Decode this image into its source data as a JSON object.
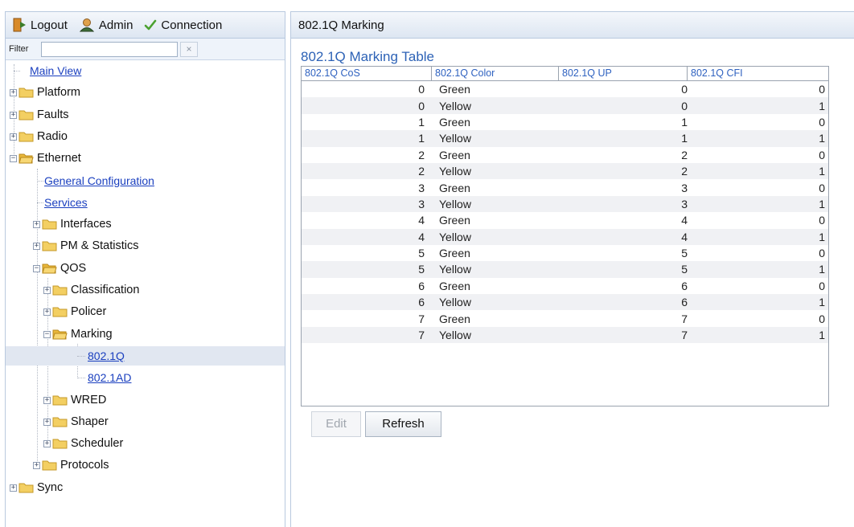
{
  "toolbar": {
    "logout_label": "Logout",
    "admin_label": "Admin",
    "connection_label": "Connection"
  },
  "filter": {
    "label": "Filter",
    "value": "",
    "clear_label": "×"
  },
  "tree": [
    {
      "id": "main-view",
      "label": "Main View",
      "kind": "link",
      "level": 0
    },
    {
      "id": "platform",
      "label": "Platform",
      "kind": "folder",
      "level": 0,
      "expanded": false
    },
    {
      "id": "faults",
      "label": "Faults",
      "kind": "folder",
      "level": 0,
      "expanded": false
    },
    {
      "id": "radio",
      "label": "Radio",
      "kind": "folder",
      "level": 0,
      "expanded": false
    },
    {
      "id": "ethernet",
      "label": "Ethernet",
      "kind": "folder",
      "level": 0,
      "expanded": true
    },
    {
      "id": "general-configuration",
      "label": "General Configuration",
      "kind": "link",
      "level": 1
    },
    {
      "id": "services",
      "label": "Services",
      "kind": "link",
      "level": 1
    },
    {
      "id": "interfaces",
      "label": "Interfaces",
      "kind": "folder",
      "level": 1,
      "expanded": false
    },
    {
      "id": "pm-statistics",
      "label": "PM & Statistics",
      "kind": "folder",
      "level": 1,
      "expanded": false
    },
    {
      "id": "qos",
      "label": "QOS",
      "kind": "folder",
      "level": 1,
      "expanded": true
    },
    {
      "id": "classification",
      "label": "Classification",
      "kind": "folder",
      "level": 2,
      "expanded": false
    },
    {
      "id": "policer",
      "label": "Policer",
      "kind": "folder",
      "level": 2,
      "expanded": false
    },
    {
      "id": "marking",
      "label": "Marking",
      "kind": "folder",
      "level": 2,
      "expanded": true
    },
    {
      "id": "802-1q",
      "label": "802.1Q",
      "kind": "link",
      "level": 3,
      "selected": true
    },
    {
      "id": "802-1ad",
      "label": "802.1AD",
      "kind": "link",
      "level": 3
    },
    {
      "id": "wred",
      "label": "WRED",
      "kind": "folder",
      "level": 2,
      "expanded": false
    },
    {
      "id": "shaper",
      "label": "Shaper",
      "kind": "folder",
      "level": 2,
      "expanded": false
    },
    {
      "id": "scheduler",
      "label": "Scheduler",
      "kind": "folder",
      "level": 2,
      "expanded": false
    },
    {
      "id": "protocols",
      "label": "Protocols",
      "kind": "folder",
      "level": 1,
      "expanded": false
    },
    {
      "id": "sync",
      "label": "Sync",
      "kind": "folder",
      "level": 0,
      "expanded": false
    }
  ],
  "panel": {
    "header": "802.1Q Marking",
    "table_title": "802.1Q Marking Table"
  },
  "table": {
    "columns": [
      "802.1Q CoS",
      "802.1Q Color",
      "802.1Q UP",
      "802.1Q CFI"
    ],
    "rows": [
      [
        "0",
        "Green",
        "0",
        "0"
      ],
      [
        "0",
        "Yellow",
        "0",
        "1"
      ],
      [
        "1",
        "Green",
        "1",
        "0"
      ],
      [
        "1",
        "Yellow",
        "1",
        "1"
      ],
      [
        "2",
        "Green",
        "2",
        "0"
      ],
      [
        "2",
        "Yellow",
        "2",
        "1"
      ],
      [
        "3",
        "Green",
        "3",
        "0"
      ],
      [
        "3",
        "Yellow",
        "3",
        "1"
      ],
      [
        "4",
        "Green",
        "4",
        "0"
      ],
      [
        "4",
        "Yellow",
        "4",
        "1"
      ],
      [
        "5",
        "Green",
        "5",
        "0"
      ],
      [
        "5",
        "Yellow",
        "5",
        "1"
      ],
      [
        "6",
        "Green",
        "6",
        "0"
      ],
      [
        "6",
        "Yellow",
        "6",
        "1"
      ],
      [
        "7",
        "Green",
        "7",
        "0"
      ],
      [
        "7",
        "Yellow",
        "7",
        "1"
      ]
    ]
  },
  "buttons": {
    "edit_label": "Edit",
    "edit_enabled": false,
    "refresh_label": "Refresh"
  },
  "colors": {
    "link": "#1a3fbf",
    "header_text": "#2f62c0",
    "title_text": "#2d62b6",
    "folder": "#f2c94c",
    "selected_row": "#e1e7f1"
  }
}
